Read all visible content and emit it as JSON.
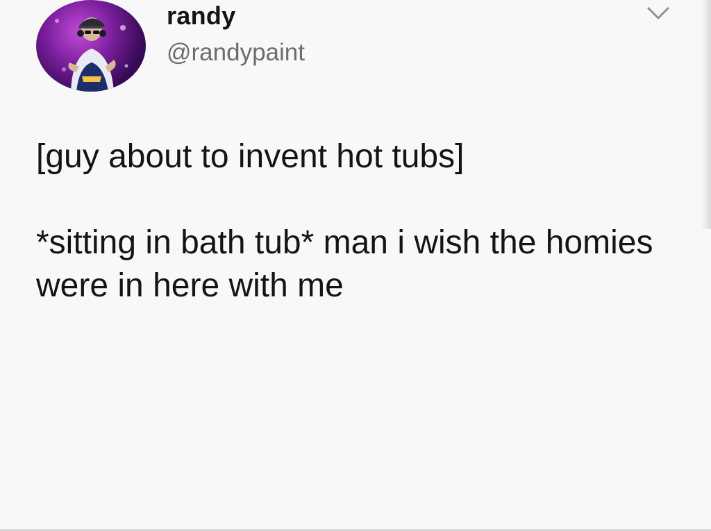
{
  "tweet": {
    "display_name": "randy",
    "handle": "@randypaint",
    "text_paragraph_1": "[guy about to invent hot tubs]",
    "text_paragraph_2": "*sitting in bath tub* man i wish the homies were in here with me"
  },
  "icons": {
    "avatar": "avatar-icon",
    "menu": "chevron-down-icon"
  },
  "colors": {
    "background": "#f8f8f8",
    "text": "#141414",
    "handle": "#6a6d70",
    "avatar_accent": "#7a1f9c"
  }
}
